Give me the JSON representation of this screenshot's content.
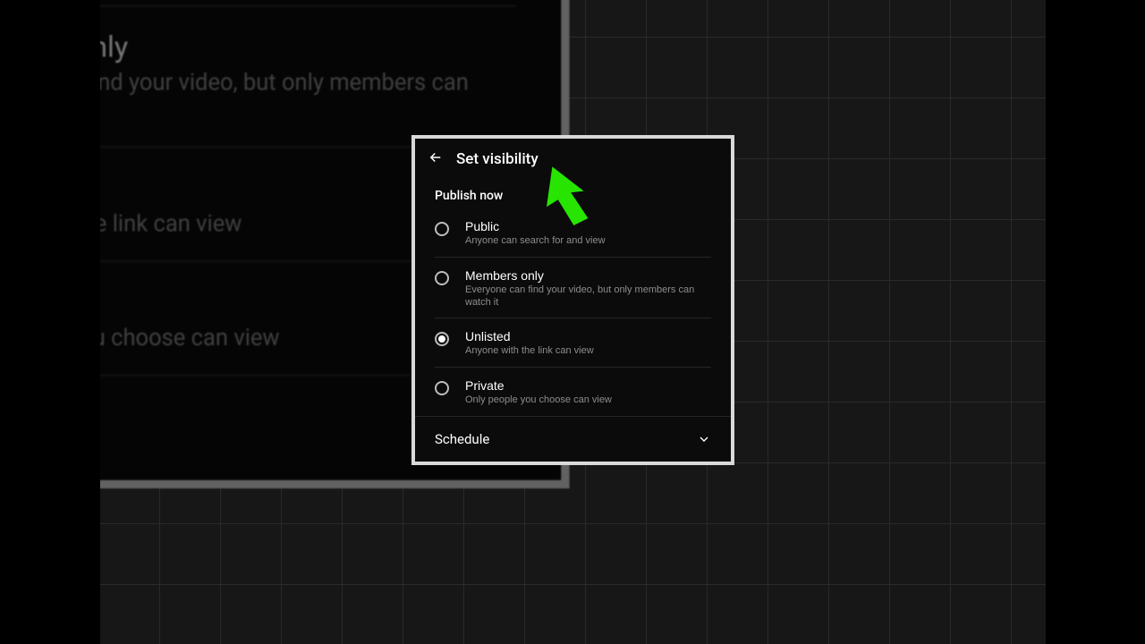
{
  "header": {
    "title": "Set visibility"
  },
  "section_label": "Publish now",
  "options": [
    {
      "title": "Public",
      "desc": "Anyone can search for and view",
      "selected": false
    },
    {
      "title": "Members only",
      "desc": "Everyone can find your video, but only members can watch it",
      "selected": false
    },
    {
      "title": "Unlisted",
      "desc": "Anyone with the link can view",
      "selected": true
    },
    {
      "title": "Private",
      "desc": "Only people you choose can view",
      "selected": false
    }
  ],
  "schedule_label": "Schedule",
  "colors": {
    "cursor": "#27e500"
  }
}
